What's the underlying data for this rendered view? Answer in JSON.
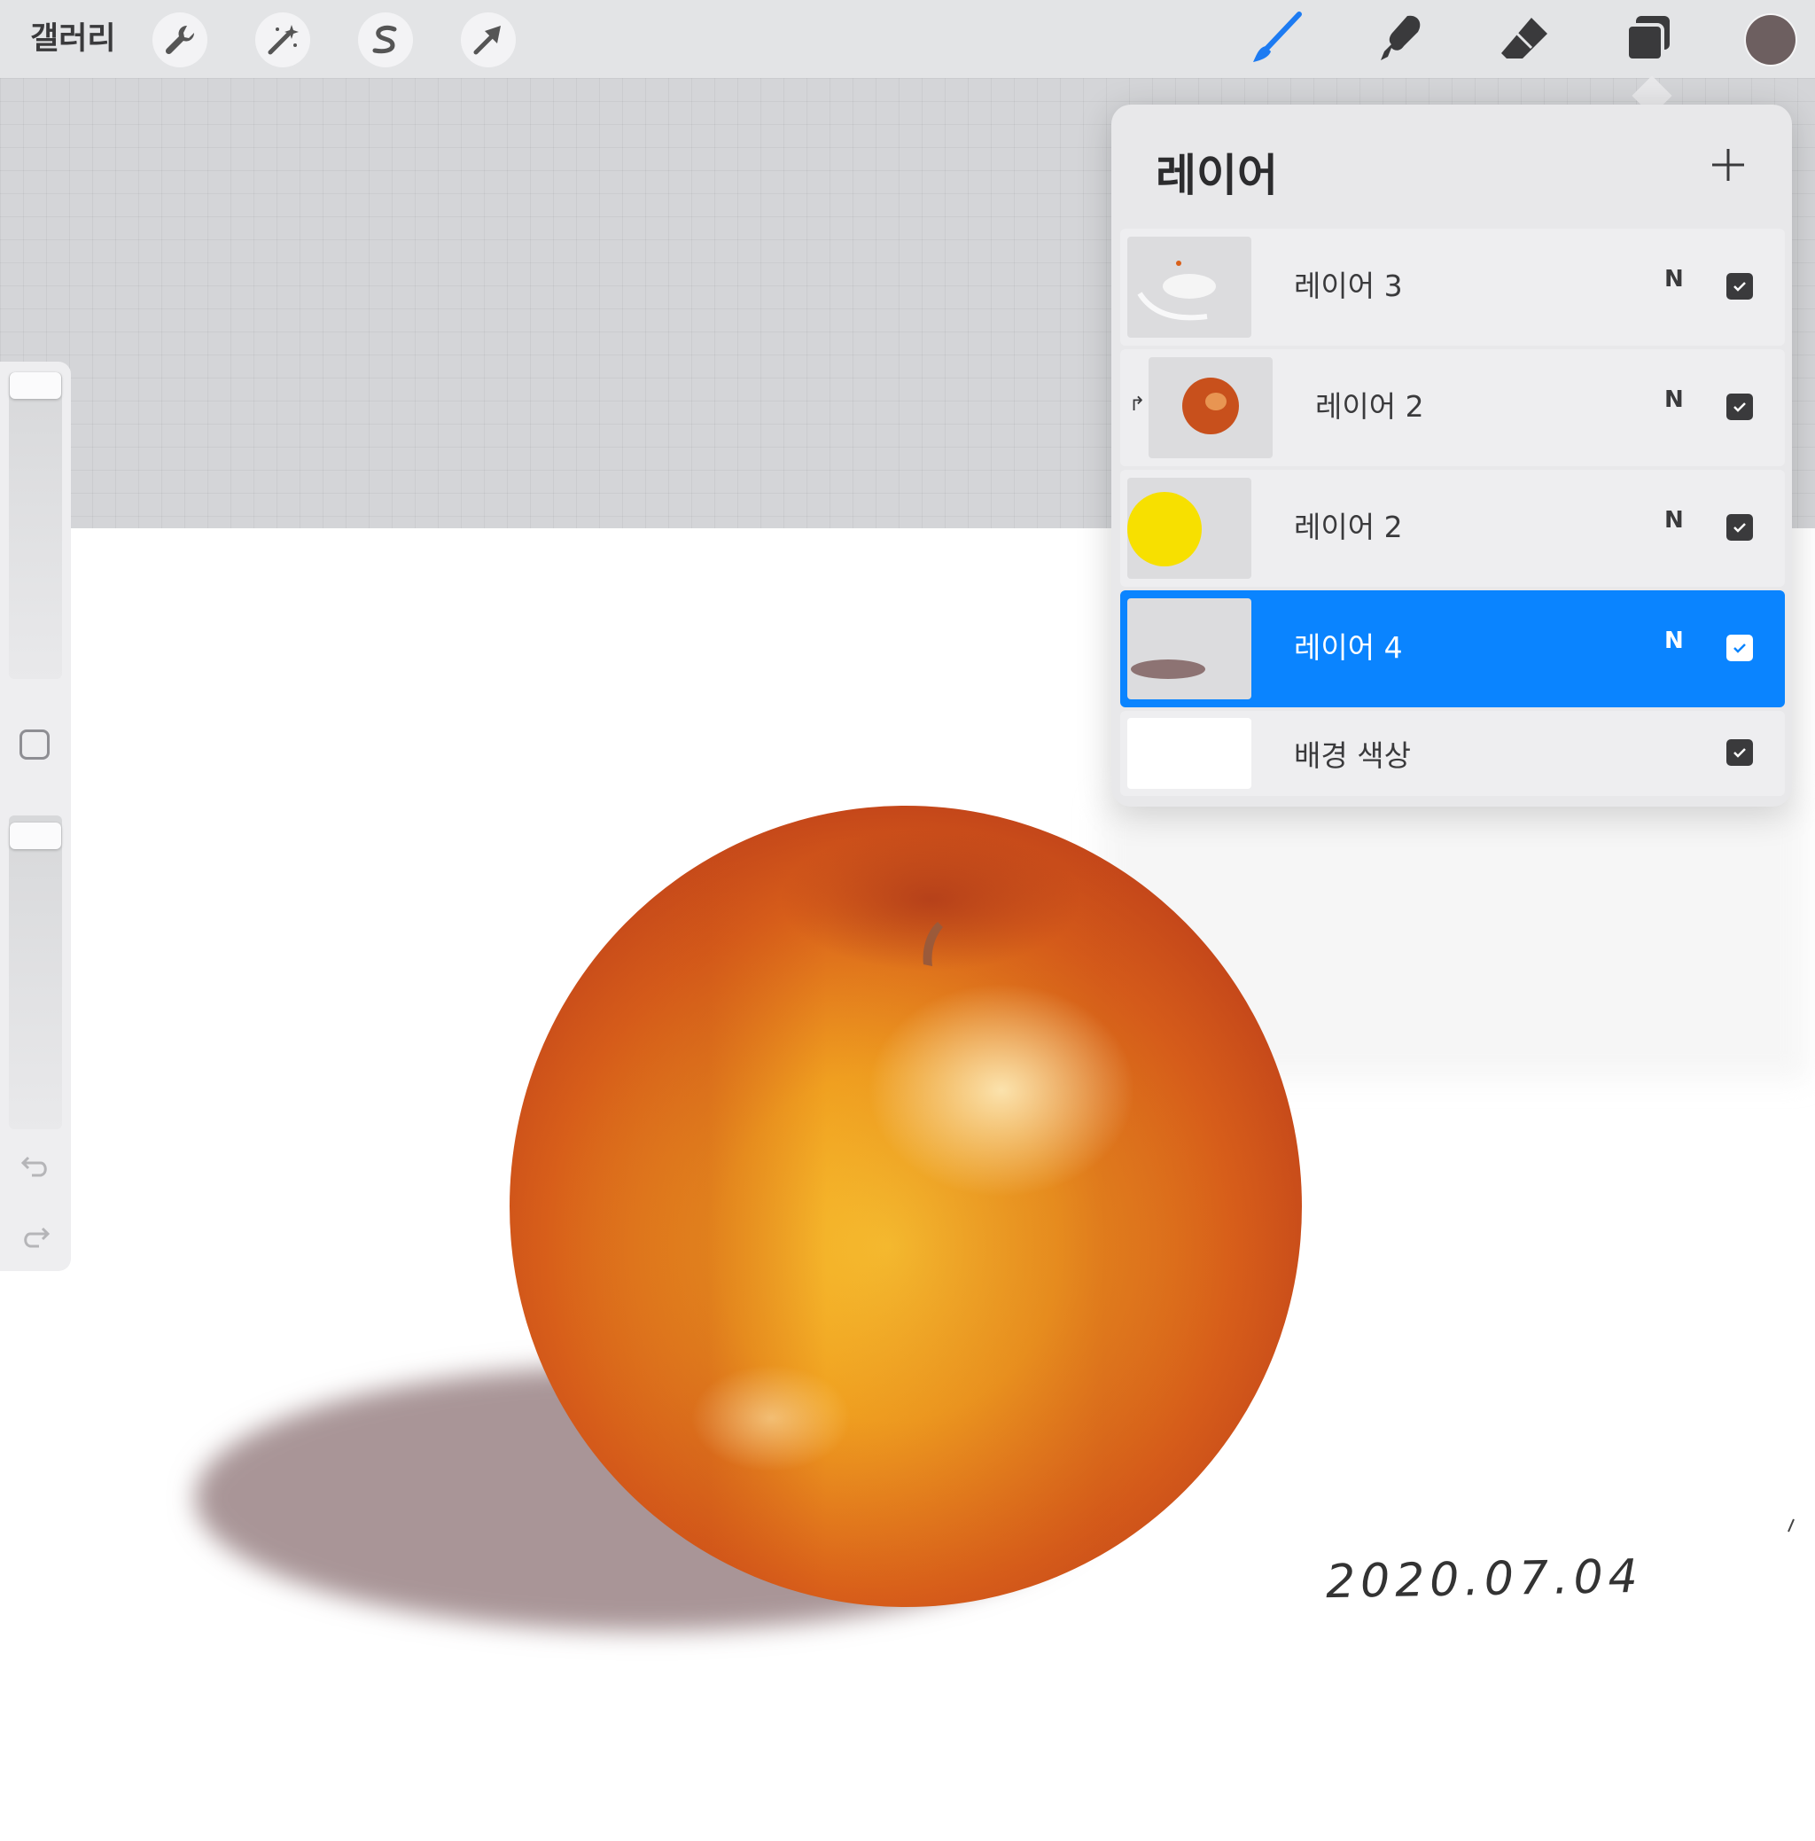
{
  "toolbar": {
    "gallery_label": "갤러리",
    "left_tools": [
      "wrench-icon",
      "magic-wand-icon",
      "selection-icon",
      "transform-arrow-icon"
    ],
    "right_tools": [
      "brush-icon",
      "smudge-icon",
      "eraser-icon",
      "layers-icon"
    ],
    "active_tool": "brush-icon",
    "accent_color": "#1d7bf2",
    "current_color": "#6d5f60"
  },
  "sidebar": {
    "brush_size": 1.0,
    "brush_opacity": 1.0,
    "modify_button": "modify-square-icon",
    "undo_icon": "undo-icon",
    "redo_icon": "redo-icon"
  },
  "layers_panel": {
    "title": "레이어",
    "add_icon": "plus-icon",
    "layers": [
      {
        "name": "레이어 3",
        "blend": "N",
        "visible": true,
        "clipped": false,
        "selected": false,
        "thumb": "highlight-layer"
      },
      {
        "name": "레이어 2",
        "blend": "N",
        "visible": true,
        "clipped": true,
        "selected": false,
        "thumb": "apple"
      },
      {
        "name": "레이어 2",
        "blend": "N",
        "visible": true,
        "clipped": false,
        "selected": false,
        "thumb": "yellow-circle"
      },
      {
        "name": "레이어 4",
        "blend": "N",
        "visible": true,
        "clipped": false,
        "selected": true,
        "thumb": "shadow"
      }
    ],
    "background": {
      "name": "배경 색상",
      "visible": true,
      "color": "#ffffff"
    },
    "selection_color": "#0a84ff"
  },
  "canvas": {
    "signature_date": "2020.07.04",
    "apple_colors": [
      "#f0a020",
      "#d9601a",
      "#b8381a"
    ],
    "shadow_color": "#a99597"
  }
}
